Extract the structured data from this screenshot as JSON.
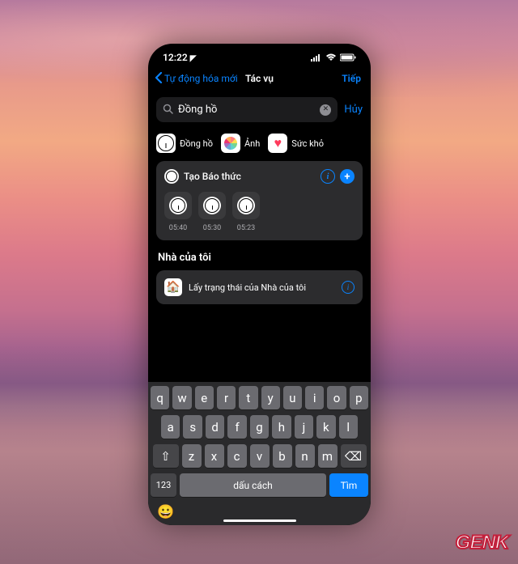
{
  "status": {
    "time": "12:22",
    "location_arrow": "➤"
  },
  "nav": {
    "back": "Tự động hóa mới",
    "title": "Tác vụ",
    "next": "Tiếp"
  },
  "search": {
    "query": "Đồng hồ",
    "cancel": "Hủy"
  },
  "apps": [
    {
      "name": "clock",
      "label": "Đồng hồ"
    },
    {
      "name": "photos",
      "label": "Ảnh"
    },
    {
      "name": "health",
      "label": "Sức khỏ"
    }
  ],
  "alarm_card": {
    "title": "Tạo Báo thức",
    "times": [
      "05:40",
      "05:30",
      "05:23"
    ]
  },
  "section": {
    "title": "Nhà của tôi"
  },
  "home_row": {
    "icon": "🏠",
    "title": "Lấy trạng thái của Nhà của tôi"
  },
  "keyboard": {
    "row1": [
      "q",
      "w",
      "e",
      "r",
      "t",
      "y",
      "u",
      "i",
      "o",
      "p"
    ],
    "row2": [
      "a",
      "s",
      "d",
      "f",
      "g",
      "h",
      "j",
      "k",
      "l"
    ],
    "row3": [
      "z",
      "x",
      "c",
      "v",
      "b",
      "n",
      "m"
    ],
    "shift": "⇧",
    "backspace": "⌫",
    "numbers": "123",
    "space": "dấu cách",
    "search": "Tìm",
    "emoji": "😀"
  },
  "watermark": "GENK"
}
